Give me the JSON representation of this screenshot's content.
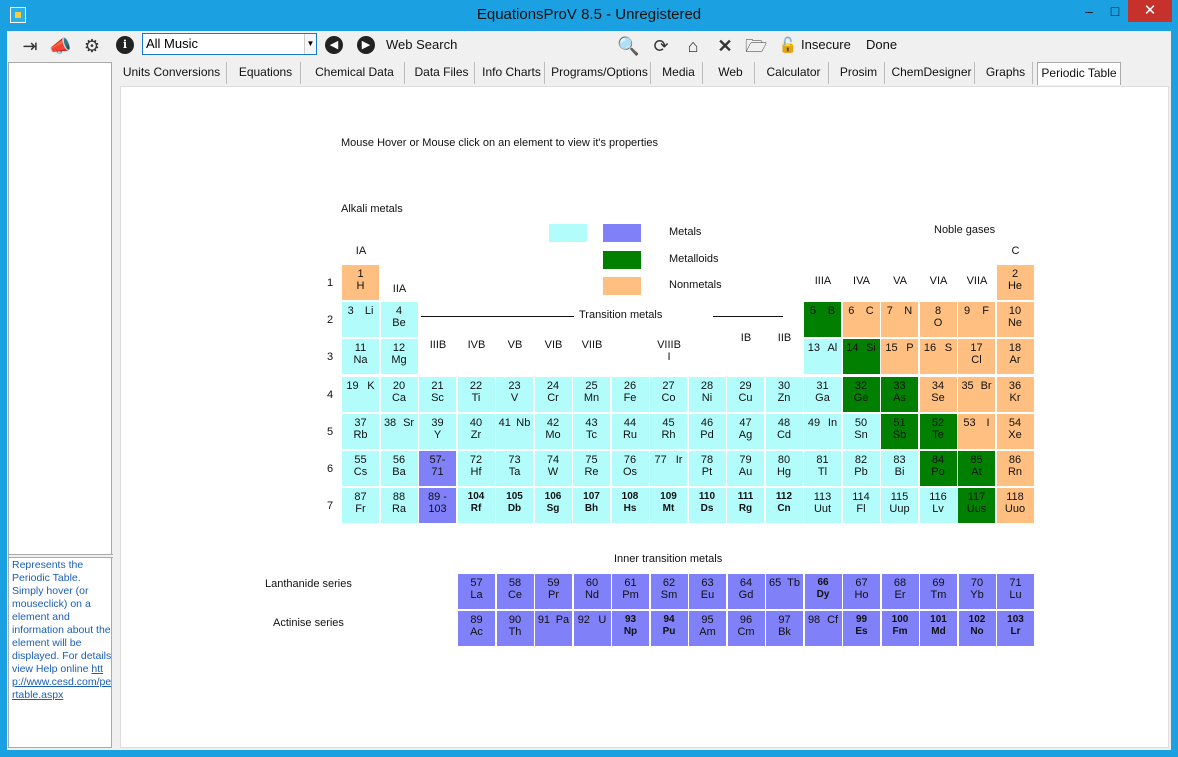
{
  "window": {
    "title": "EquationsProV 8.5 - Unregistered"
  },
  "toolbar": {
    "search_value": "All Music",
    "web_search_label": "Web Search",
    "insecure_label": "Insecure",
    "done_label": "Done"
  },
  "tabs": [
    "Units Conversions",
    "Equations",
    "Chemical Data",
    "Data Files",
    "Info Charts",
    "Programs/Options",
    "Media",
    "Web",
    "Calculator",
    "Prosim",
    "ChemDesigner",
    "Graphs",
    "Periodic Table"
  ],
  "left_panel": {
    "description": "Represents the Periodic Table. Simply hover (or mouseclick) on a element and information about the element will be displayed. For details view Help online",
    "link": "http://www.cesd.com/pertable.aspx"
  },
  "periodic": {
    "instruction": "Mouse Hover or Mouse click on an element to view it's properties",
    "alkali_label": "Alkali metals",
    "noble_label": "Noble gases",
    "transition_label": "Transition metals",
    "inner_transition_label": "Inner transition metals",
    "lanthanide_label": "Lanthanide series",
    "actinide_label": "Actinise series",
    "legend": [
      {
        "label": "",
        "color": "#b3fcfc"
      },
      {
        "label": "Metals",
        "color": "#8080f8"
      },
      {
        "label": "Metalloids",
        "color": "#007f00"
      },
      {
        "label": "Nonmetals",
        "color": "#ffbf80"
      }
    ],
    "group_labels": {
      "IA": "IA",
      "IIA": "IIA",
      "IIIB": "IIIB",
      "IVB": "IVB",
      "VB": "VB",
      "VIB": "VIB",
      "VIIB": "VIIB",
      "VIIIB": "VIIIB\nI",
      "IB": "IB",
      "IIB": "IIB",
      "IIIA": "IIIA",
      "IVA": "IVA",
      "VA": "VA",
      "VIA": "VIA",
      "VIIA": "VIIA",
      "C": "C"
    },
    "period_labels": [
      "1",
      "2",
      "3",
      "4",
      "5",
      "6",
      "7"
    ]
  },
  "elements": [
    {
      "n": "1",
      "s": "H",
      "r": 0,
      "c": 0,
      "t": "nm"
    },
    {
      "n": "2",
      "s": "He",
      "r": 0,
      "c": 17,
      "t": "nm"
    },
    {
      "n": "3",
      "s": "Li",
      "r": 1,
      "c": 0,
      "t": "m",
      "inline": true
    },
    {
      "n": "4",
      "s": "Be",
      "r": 1,
      "c": 1,
      "t": "m"
    },
    {
      "n": "5",
      "s": "B",
      "r": 1,
      "c": 12,
      "t": "ml",
      "inline": true
    },
    {
      "n": "6",
      "s": "C",
      "r": 1,
      "c": 13,
      "t": "nm",
      "inline": true
    },
    {
      "n": "7",
      "s": "N",
      "r": 1,
      "c": 14,
      "t": "nm",
      "inline": true
    },
    {
      "n": "8",
      "s": "O",
      "r": 1,
      "c": 15,
      "t": "nm"
    },
    {
      "n": "9",
      "s": "F",
      "r": 1,
      "c": 16,
      "t": "nm",
      "inline": true
    },
    {
      "n": "10",
      "s": "Ne",
      "r": 1,
      "c": 17,
      "t": "nm"
    },
    {
      "n": "11",
      "s": "Na",
      "r": 2,
      "c": 0,
      "t": "m"
    },
    {
      "n": "12",
      "s": "Mg",
      "r": 2,
      "c": 1,
      "t": "m"
    },
    {
      "n": "13",
      "s": "Al",
      "r": 2,
      "c": 12,
      "t": "m",
      "inline": true
    },
    {
      "n": "14",
      "s": "Si",
      "r": 2,
      "c": 13,
      "t": "ml",
      "inline": true
    },
    {
      "n": "15",
      "s": "P",
      "r": 2,
      "c": 14,
      "t": "nm",
      "inline": true
    },
    {
      "n": "16",
      "s": "S",
      "r": 2,
      "c": 15,
      "t": "nm",
      "inline": true
    },
    {
      "n": "17",
      "s": "Cl",
      "r": 2,
      "c": 16,
      "t": "nm"
    },
    {
      "n": "18",
      "s": "Ar",
      "r": 2,
      "c": 17,
      "t": "nm"
    },
    {
      "n": "19",
      "s": "K",
      "r": 3,
      "c": 0,
      "t": "m",
      "inline": true
    },
    {
      "n": "20",
      "s": "Ca",
      "r": 3,
      "c": 1,
      "t": "m"
    },
    {
      "n": "21",
      "s": "Sc",
      "r": 3,
      "c": 2,
      "t": "m"
    },
    {
      "n": "22",
      "s": "Ti",
      "r": 3,
      "c": 3,
      "t": "m"
    },
    {
      "n": "23",
      "s": "V",
      "r": 3,
      "c": 4,
      "t": "m"
    },
    {
      "n": "24",
      "s": "Cr",
      "r": 3,
      "c": 5,
      "t": "m"
    },
    {
      "n": "25",
      "s": "Mn",
      "r": 3,
      "c": 6,
      "t": "m"
    },
    {
      "n": "26",
      "s": "Fe",
      "r": 3,
      "c": 7,
      "t": "m"
    },
    {
      "n": "27",
      "s": "Co",
      "r": 3,
      "c": 8,
      "t": "m"
    },
    {
      "n": "28",
      "s": "Ni",
      "r": 3,
      "c": 9,
      "t": "m"
    },
    {
      "n": "29",
      "s": "Cu",
      "r": 3,
      "c": 10,
      "t": "m"
    },
    {
      "n": "30",
      "s": "Zn",
      "r": 3,
      "c": 11,
      "t": "m"
    },
    {
      "n": "31",
      "s": "Ga",
      "r": 3,
      "c": 12,
      "t": "m"
    },
    {
      "n": "32",
      "s": "Ge",
      "r": 3,
      "c": 13,
      "t": "ml"
    },
    {
      "n": "33",
      "s": "As",
      "r": 3,
      "c": 14,
      "t": "ml"
    },
    {
      "n": "34",
      "s": "Se",
      "r": 3,
      "c": 15,
      "t": "nm"
    },
    {
      "n": "35",
      "s": "Br",
      "r": 3,
      "c": 16,
      "t": "nm",
      "inline": true
    },
    {
      "n": "36",
      "s": "Kr",
      "r": 3,
      "c": 17,
      "t": "nm"
    },
    {
      "n": "37",
      "s": "Rb",
      "r": 4,
      "c": 0,
      "t": "m"
    },
    {
      "n": "38",
      "s": "Sr",
      "r": 4,
      "c": 1,
      "t": "m",
      "inline": true
    },
    {
      "n": "39",
      "s": "Y",
      "r": 4,
      "c": 2,
      "t": "m"
    },
    {
      "n": "40",
      "s": "Zr",
      "r": 4,
      "c": 3,
      "t": "m"
    },
    {
      "n": "41",
      "s": "Nb",
      "r": 4,
      "c": 4,
      "t": "m",
      "inline": true
    },
    {
      "n": "42",
      "s": "Mo",
      "r": 4,
      "c": 5,
      "t": "m"
    },
    {
      "n": "43",
      "s": "Tc",
      "r": 4,
      "c": 6,
      "t": "m"
    },
    {
      "n": "44",
      "s": "Ru",
      "r": 4,
      "c": 7,
      "t": "m"
    },
    {
      "n": "45",
      "s": "Rh",
      "r": 4,
      "c": 8,
      "t": "m"
    },
    {
      "n": "46",
      "s": "Pd",
      "r": 4,
      "c": 9,
      "t": "m"
    },
    {
      "n": "47",
      "s": "Ag",
      "r": 4,
      "c": 10,
      "t": "m"
    },
    {
      "n": "48",
      "s": "Cd",
      "r": 4,
      "c": 11,
      "t": "m"
    },
    {
      "n": "49",
      "s": "In",
      "r": 4,
      "c": 12,
      "t": "m",
      "inline": true
    },
    {
      "n": "50",
      "s": "Sn",
      "r": 4,
      "c": 13,
      "t": "m"
    },
    {
      "n": "51",
      "s": "Sb",
      "r": 4,
      "c": 14,
      "t": "ml"
    },
    {
      "n": "52",
      "s": "Te",
      "r": 4,
      "c": 15,
      "t": "ml"
    },
    {
      "n": "53",
      "s": "I",
      "r": 4,
      "c": 16,
      "t": "nm",
      "inline": true
    },
    {
      "n": "54",
      "s": "Xe",
      "r": 4,
      "c": 17,
      "t": "nm"
    },
    {
      "n": "55",
      "s": "Cs",
      "r": 5,
      "c": 0,
      "t": "m"
    },
    {
      "n": "56",
      "s": "Ba",
      "r": 5,
      "c": 1,
      "t": "m"
    },
    {
      "n": "57-",
      "s": "71",
      "r": 5,
      "c": 2,
      "t": "mt"
    },
    {
      "n": "72",
      "s": "Hf",
      "r": 5,
      "c": 3,
      "t": "m"
    },
    {
      "n": "73",
      "s": "Ta",
      "r": 5,
      "c": 4,
      "t": "m"
    },
    {
      "n": "74",
      "s": "W",
      "r": 5,
      "c": 5,
      "t": "m"
    },
    {
      "n": "75",
      "s": "Re",
      "r": 5,
      "c": 6,
      "t": "m"
    },
    {
      "n": "76",
      "s": "Os",
      "r": 5,
      "c": 7,
      "t": "m"
    },
    {
      "n": "77",
      "s": "Ir",
      "r": 5,
      "c": 8,
      "t": "m",
      "inline": true
    },
    {
      "n": "78",
      "s": "Pt",
      "r": 5,
      "c": 9,
      "t": "m"
    },
    {
      "n": "79",
      "s": "Au",
      "r": 5,
      "c": 10,
      "t": "m"
    },
    {
      "n": "80",
      "s": "Hg",
      "r": 5,
      "c": 11,
      "t": "m"
    },
    {
      "n": "81",
      "s": "Tl",
      "r": 5,
      "c": 12,
      "t": "m"
    },
    {
      "n": "82",
      "s": "Pb",
      "r": 5,
      "c": 13,
      "t": "m"
    },
    {
      "n": "83",
      "s": "Bi",
      "r": 5,
      "c": 14,
      "t": "m"
    },
    {
      "n": "84",
      "s": "Po",
      "r": 5,
      "c": 15,
      "t": "ml"
    },
    {
      "n": "85",
      "s": "At",
      "r": 5,
      "c": 16,
      "t": "ml"
    },
    {
      "n": "86",
      "s": "Rn",
      "r": 5,
      "c": 17,
      "t": "nm"
    },
    {
      "n": "87",
      "s": "Fr",
      "r": 6,
      "c": 0,
      "t": "m"
    },
    {
      "n": "88",
      "s": "Ra",
      "r": 6,
      "c": 1,
      "t": "m"
    },
    {
      "n": "89 -",
      "s": "103",
      "r": 6,
      "c": 2,
      "t": "mt"
    },
    {
      "n": "104",
      "s": "Rf",
      "r": 6,
      "c": 3,
      "t": "m",
      "b": true
    },
    {
      "n": "105",
      "s": "Db",
      "r": 6,
      "c": 4,
      "t": "m",
      "b": true
    },
    {
      "n": "106",
      "s": "Sg",
      "r": 6,
      "c": 5,
      "t": "m",
      "b": true
    },
    {
      "n": "107",
      "s": "Bh",
      "r": 6,
      "c": 6,
      "t": "m",
      "b": true
    },
    {
      "n": "108",
      "s": "Hs",
      "r": 6,
      "c": 7,
      "t": "m",
      "b": true
    },
    {
      "n": "109",
      "s": "Mt",
      "r": 6,
      "c": 8,
      "t": "m",
      "b": true
    },
    {
      "n": "110",
      "s": "Ds",
      "r": 6,
      "c": 9,
      "t": "m",
      "b": true
    },
    {
      "n": "111",
      "s": "Rg",
      "r": 6,
      "c": 10,
      "t": "m",
      "b": true
    },
    {
      "n": "112",
      "s": "Cn",
      "r": 6,
      "c": 11,
      "t": "m",
      "b": true
    },
    {
      "n": "113",
      "s": "Uut",
      "r": 6,
      "c": 12,
      "t": "m"
    },
    {
      "n": "114",
      "s": "Fl",
      "r": 6,
      "c": 13,
      "t": "m"
    },
    {
      "n": "115",
      "s": "Uup",
      "r": 6,
      "c": 14,
      "t": "m"
    },
    {
      "n": "116",
      "s": "Lv",
      "r": 6,
      "c": 15,
      "t": "m"
    },
    {
      "n": "117",
      "s": "Uus",
      "r": 6,
      "c": 16,
      "t": "ml"
    },
    {
      "n": "118",
      "s": "Uuo",
      "r": 6,
      "c": 17,
      "t": "nm"
    }
  ],
  "lanthanides": [
    {
      "n": "57",
      "s": "La"
    },
    {
      "n": "58",
      "s": "Ce"
    },
    {
      "n": "59",
      "s": "Pr"
    },
    {
      "n": "60",
      "s": "Nd"
    },
    {
      "n": "61",
      "s": "Pm"
    },
    {
      "n": "62",
      "s": "Sm"
    },
    {
      "n": "63",
      "s": "Eu"
    },
    {
      "n": "64",
      "s": "Gd"
    },
    {
      "n": "65",
      "s": "Tb",
      "inline": true
    },
    {
      "n": "66",
      "s": "Dy",
      "b": true
    },
    {
      "n": "67",
      "s": "Ho"
    },
    {
      "n": "68",
      "s": "Er"
    },
    {
      "n": "69",
      "s": "Tm"
    },
    {
      "n": "70",
      "s": "Yb"
    },
    {
      "n": "71",
      "s": "Lu"
    }
  ],
  "actinides": [
    {
      "n": "89",
      "s": "Ac"
    },
    {
      "n": "90",
      "s": "Th"
    },
    {
      "n": "91",
      "s": "Pa",
      "inline": true
    },
    {
      "n": "92",
      "s": "U",
      "inline": true
    },
    {
      "n": "93",
      "s": "Np",
      "b": true
    },
    {
      "n": "94",
      "s": "Pu",
      "b": true
    },
    {
      "n": "95",
      "s": "Am"
    },
    {
      "n": "96",
      "s": "Cm"
    },
    {
      "n": "97",
      "s": "Bk"
    },
    {
      "n": "98",
      "s": "Cf",
      "inline": true
    },
    {
      "n": "99",
      "s": "Es",
      "b": true
    },
    {
      "n": "100",
      "s": "Fm",
      "b": true
    },
    {
      "n": "101",
      "s": "Md",
      "b": true
    },
    {
      "n": "102",
      "s": "No",
      "b": true
    },
    {
      "n": "103",
      "s": "Lr",
      "b": true
    }
  ]
}
